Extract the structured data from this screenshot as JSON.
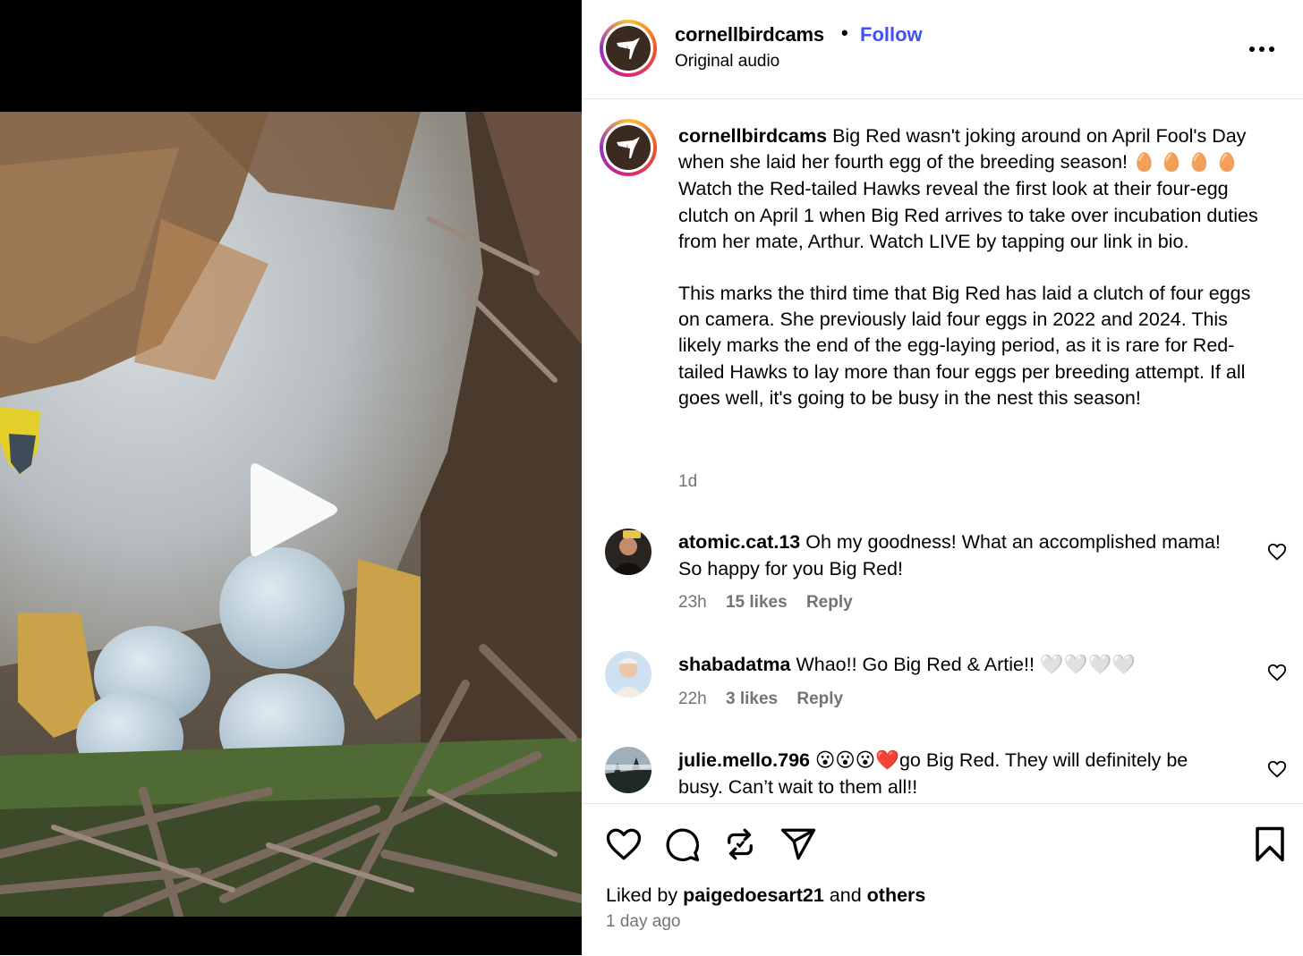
{
  "header": {
    "username": "cornellbirdcams",
    "separator": "•",
    "follow_label": "Follow",
    "audio": "Original audio",
    "more_label": "•••"
  },
  "caption": {
    "username": "cornellbirdcams",
    "paragraph1_a": "Big Red wasn't joking around on April Fool's Day when she laid her fourth egg of the breeding season!",
    "egg_emoji": "🥚",
    "paragraph1_b": "Watch the Red-tailed Hawks reveal the first look at their four-egg clutch on April 1 when Big Red arrives to take over incubation duties from her mate, Arthur. Watch LIVE by tapping our link in bio.",
    "paragraph2": "This marks the third time that Big Red has laid a clutch of four eggs on camera. She previously laid four eggs in 2022 and 2024. This likely marks the end of the egg-laying period, as it is rare for Red-tailed Hawks to lay more than four eggs per breeding attempt. If all goes well, it's going to be busy in the nest this season!",
    "time": "1d"
  },
  "comments": [
    {
      "username": "atomic.cat.13",
      "text": "Oh my goodness! What an accomplished mama! So happy for you Big Red!",
      "time": "23h",
      "likes": "15 likes",
      "reply": "Reply"
    },
    {
      "username": "shabadatma",
      "text": "Whao!! Go Big Red & Artie!! 🤍🤍🤍🤍",
      "time": "22h",
      "likes": "3 likes",
      "reply": "Reply"
    },
    {
      "username": "julie.mello.796",
      "text": "😮😮😮❤️go Big Red. They will definitely be busy. Can’t wait to them all!!",
      "time": "",
      "likes": "",
      "reply": ""
    }
  ],
  "footer": {
    "liked_prefix": "Liked by",
    "liked_user": "paigedoesart21",
    "liked_and": "and",
    "liked_others": "others",
    "date": "1 day ago"
  },
  "colors": {
    "follow": "#4150f7",
    "muted_text": "#737373",
    "divider": "#e3e3e3"
  },
  "icons": [
    "play-icon",
    "more-icon",
    "heart-icon",
    "comment-icon",
    "repost-icon",
    "share-icon",
    "bookmark-icon"
  ]
}
